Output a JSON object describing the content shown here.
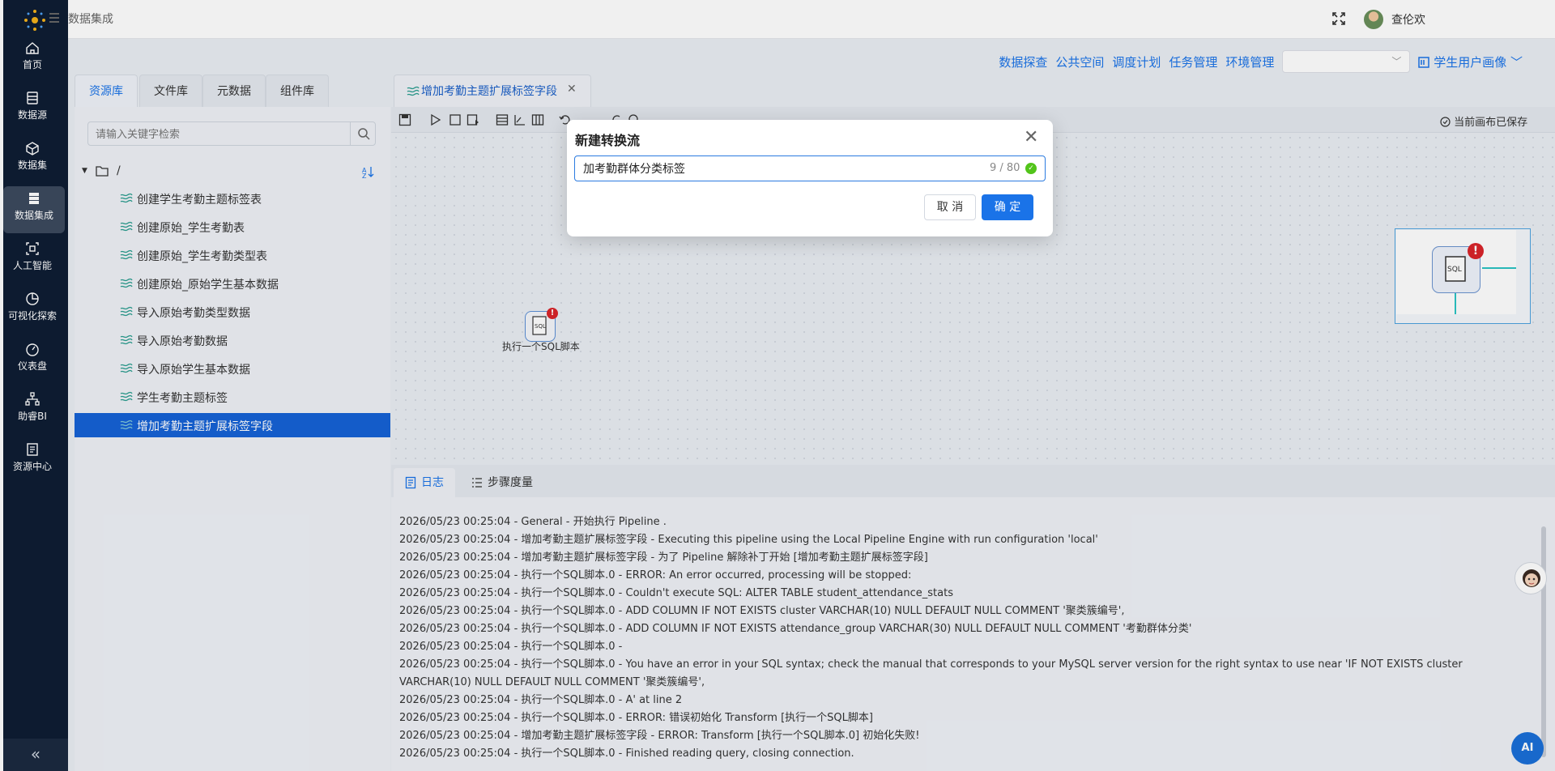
{
  "topbar": {
    "breadcrumb": "数据集成",
    "username": "查伦欢"
  },
  "sidebar": {
    "items": [
      {
        "label": "首页",
        "icon": "home-icon"
      },
      {
        "label": "数据源",
        "icon": "database-icon"
      },
      {
        "label": "数据集",
        "icon": "cube-icon"
      },
      {
        "label": "数据集成",
        "icon": "server-icon",
        "active": true
      },
      {
        "label": "人工智能",
        "icon": "ai-icon"
      },
      {
        "label": "可视化探索",
        "icon": "pie-chart-icon"
      },
      {
        "label": "仪表盘",
        "icon": "dashboard-icon"
      },
      {
        "label": "助睿BI",
        "icon": "org-chart-icon"
      },
      {
        "label": "资源中心",
        "icon": "resource-icon"
      }
    ],
    "collapse_label": "«"
  },
  "subnav": {
    "links": [
      "数据探查",
      "公共空间",
      "调度计划",
      "任务管理",
      "环境管理"
    ],
    "env_select_value": "",
    "project": "学生用户画像"
  },
  "left_panel": {
    "tabs": [
      "资源库",
      "文件库",
      "元数据",
      "组件库"
    ],
    "active_tab": 0,
    "search_placeholder": "请输入关键字检索",
    "root_label": "/",
    "items": [
      "创建学生考勤主题标签表",
      "创建原始_学生考勤表",
      "创建原始_学生考勤类型表",
      "创建原始_原始学生基本数据",
      "导入原始考勤类型数据",
      "导入原始考勤数据",
      "导入原始学生基本数据",
      "学生考勤主题标签",
      "增加考勤主题扩展标签字段"
    ],
    "selected_index": 8
  },
  "work": {
    "tab_label": "增加考勤主题扩展标签字段",
    "close_glyph": "✕",
    "saved_status": "当前画布已保存",
    "node_label": "执行一个SQL脚本",
    "node_badge": "!"
  },
  "log": {
    "tabs": [
      "日志",
      "步骤度量"
    ],
    "lines": [
      "2026/05/23 00:25:04 - General - 开始执行 Pipeline .",
      "2026/05/23 00:25:04 - 增加考勤主题扩展标签字段 - Executing this pipeline using the Local Pipeline Engine with run configuration 'local'",
      "2026/05/23 00:25:04 - 增加考勤主题扩展标签字段 - 为了 Pipeline 解除补丁开始 [增加考勤主题扩展标签字段]",
      "2026/05/23 00:25:04 - 执行一个SQL脚本.0 - ERROR: An error occurred, processing will be stopped:",
      "2026/05/23 00:25:04 - 执行一个SQL脚本.0 - Couldn't execute SQL: ALTER TABLE student_attendance_stats",
      "2026/05/23 00:25:04 - 执行一个SQL脚本.0 - ADD COLUMN IF NOT EXISTS cluster VARCHAR(10) NULL DEFAULT NULL COMMENT '聚类簇编号',",
      "2026/05/23 00:25:04 - 执行一个SQL脚本.0 - ADD COLUMN IF NOT EXISTS attendance_group VARCHAR(30) NULL DEFAULT NULL COMMENT '考勤群体分类'",
      "2026/05/23 00:25:04 - 执行一个SQL脚本.0 -",
      "2026/05/23 00:25:04 - 执行一个SQL脚本.0 - You have an error in your SQL syntax; check the manual that corresponds to your MySQL server version for the right syntax to use near 'IF NOT EXISTS cluster VARCHAR(10) NULL DEFAULT NULL COMMENT '聚类簇编号',",
      "2026/05/23 00:25:04 - 执行一个SQL脚本.0 - A' at line 2",
      "2026/05/23 00:25:04 - 执行一个SQL脚本.0 - ERROR: 错误初始化 Transform [执行一个SQL脚本]",
      "2026/05/23 00:25:04 - 增加考勤主题扩展标签字段 - ERROR: Transform [执行一个SQL脚本.0] 初始化失败!",
      "2026/05/23 00:25:04 - 执行一个SQL脚本.0 - Finished reading query, closing connection."
    ]
  },
  "modal": {
    "title": "新建转换流",
    "close_glyph": "✕",
    "input_value": "加考勤群体分类标签",
    "char_count": "9 / 80",
    "cancel_label": "取 消",
    "ok_label": "确 定"
  },
  "floating": {
    "ai_label": "AI"
  },
  "colors": {
    "sidebar_bg": "#0e1d33",
    "accent": "#1a73e8",
    "selected_row": "#1662d6",
    "error_badge": "#d9252a",
    "success": "#52c41a"
  }
}
